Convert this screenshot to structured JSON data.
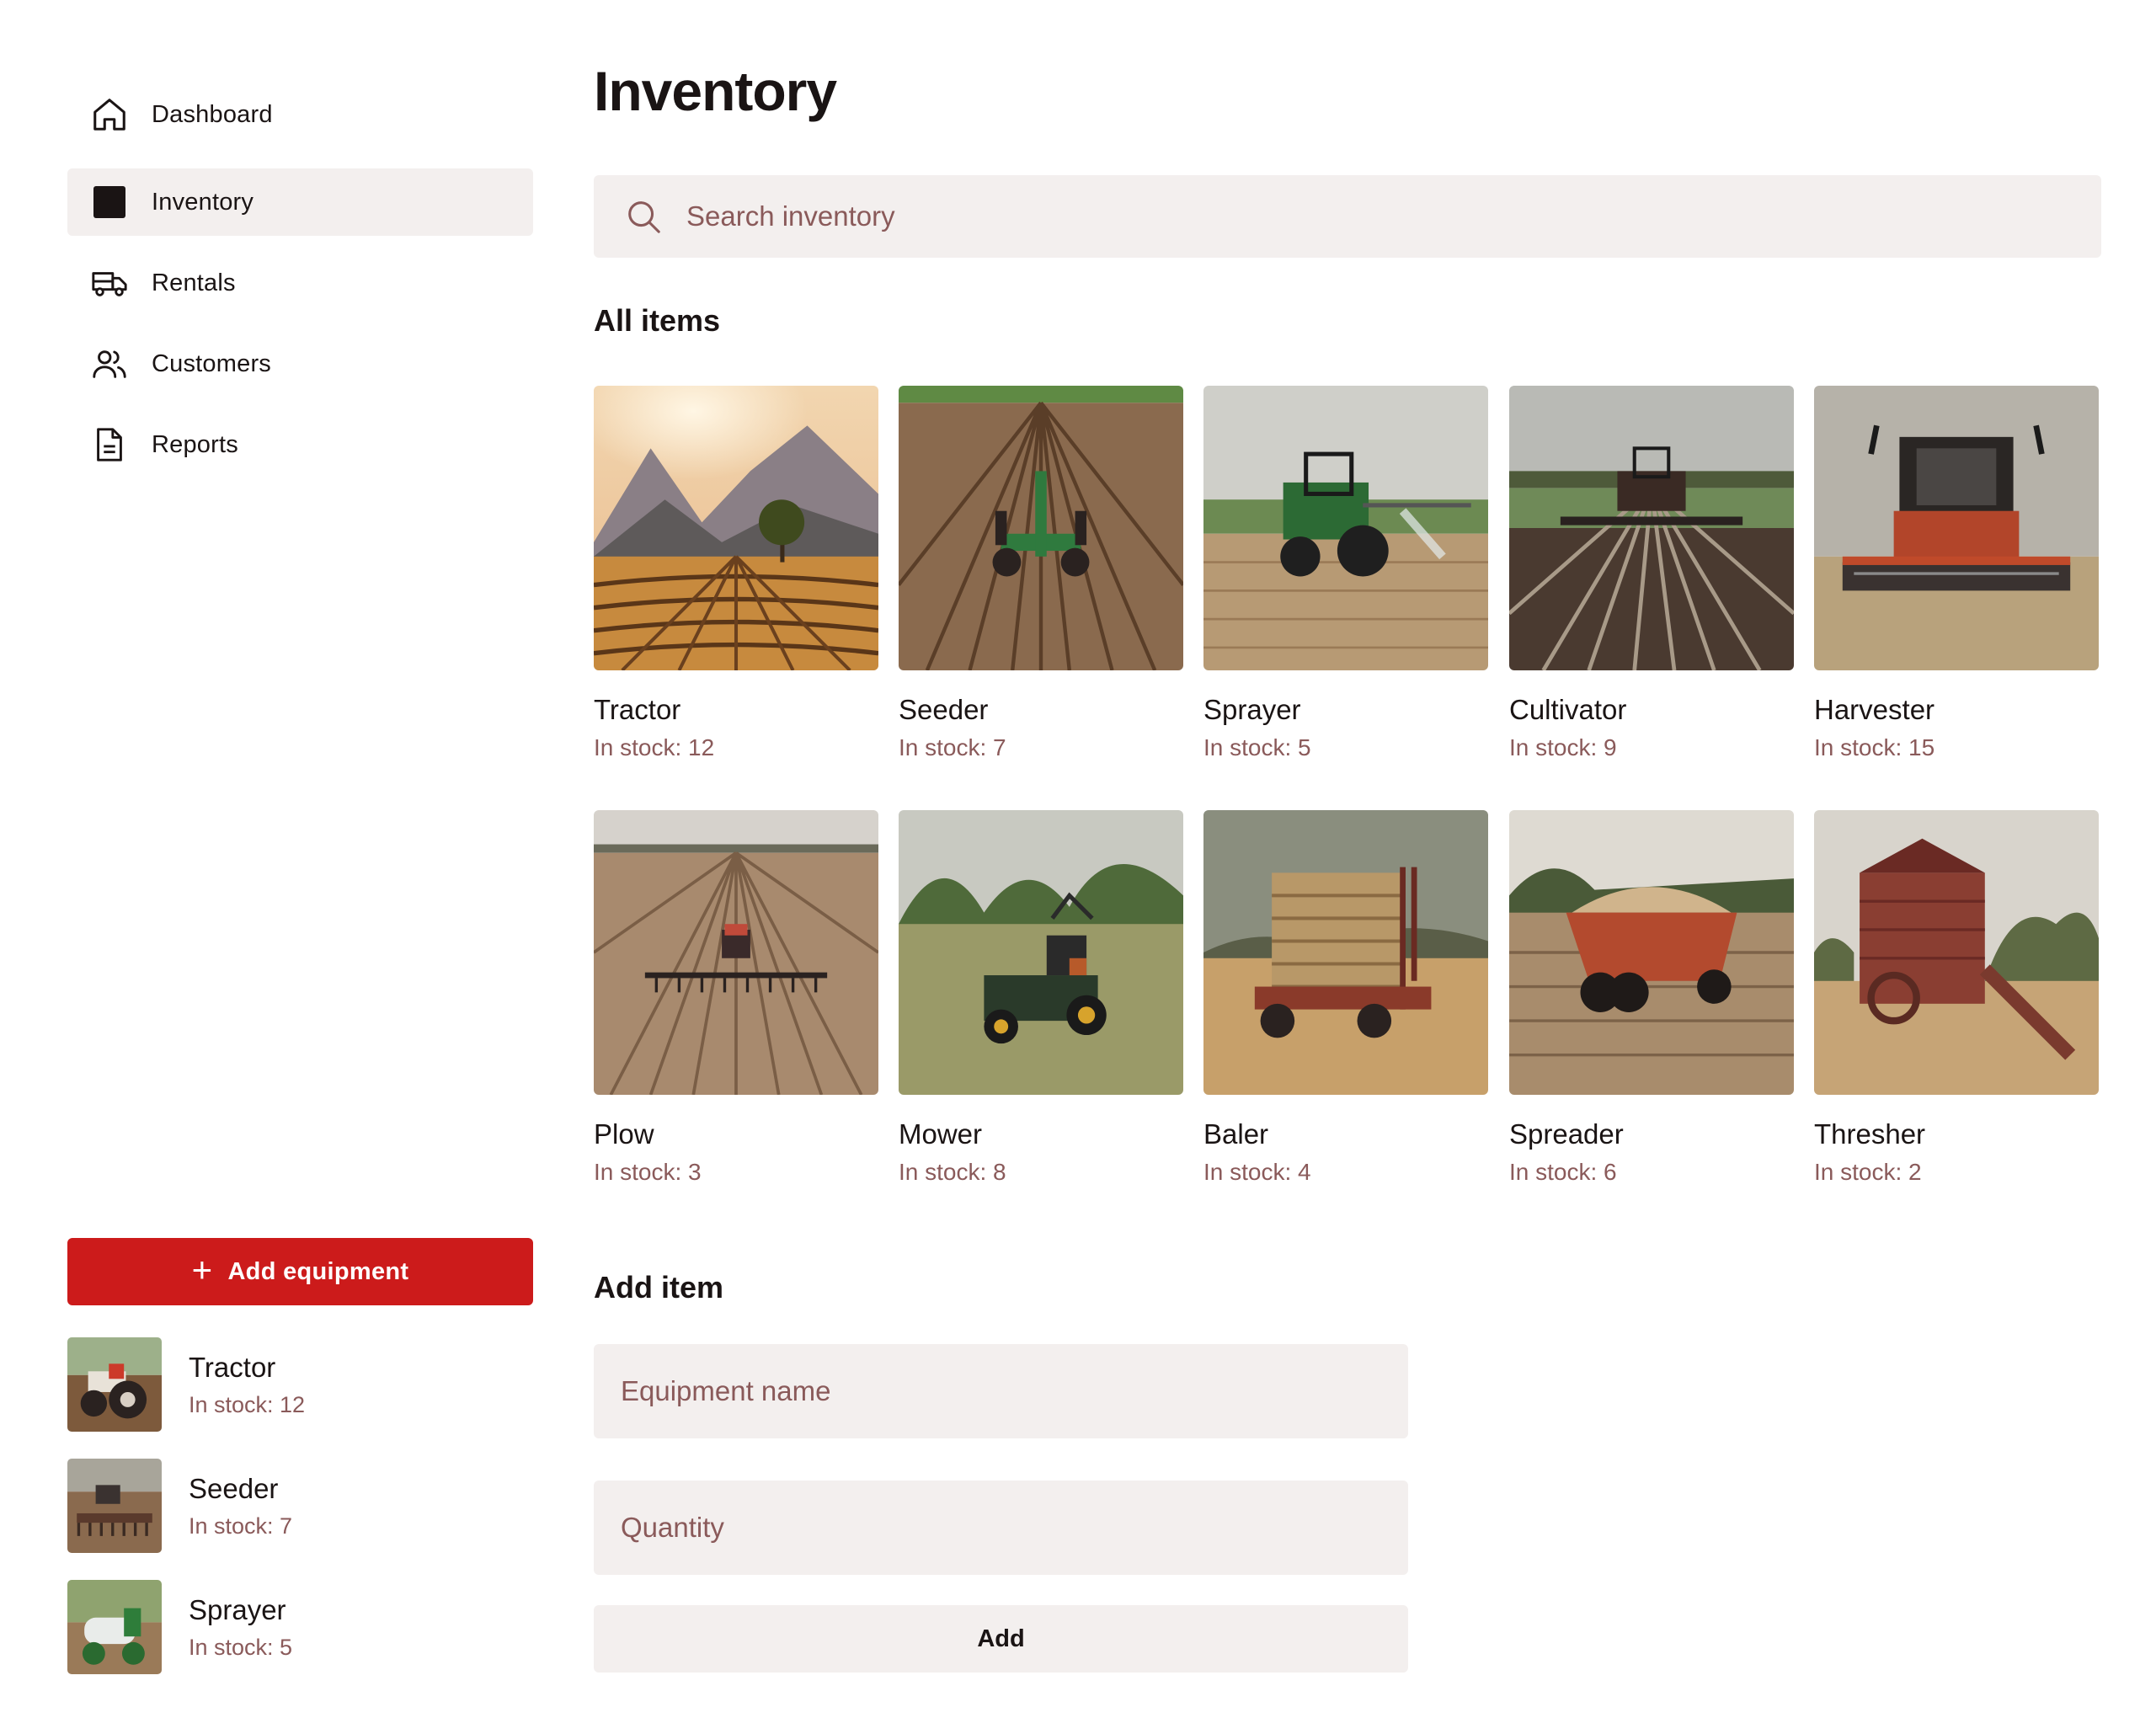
{
  "sidebar": {
    "nav": [
      {
        "label": "Dashboard",
        "icon": "home-icon",
        "active": false
      },
      {
        "label": "Inventory",
        "icon": "square-icon",
        "active": true
      },
      {
        "label": "Rentals",
        "icon": "truck-icon",
        "active": false
      },
      {
        "label": "Customers",
        "icon": "users-icon",
        "active": false
      },
      {
        "label": "Reports",
        "icon": "document-icon",
        "active": false
      }
    ],
    "add_button": {
      "label": "Add equipment",
      "icon": "plus-icon",
      "color": "#cc1b1b"
    },
    "recent": [
      {
        "name": "Tractor",
        "stock": "In stock: 12"
      },
      {
        "name": "Seeder",
        "stock": "In stock: 7"
      },
      {
        "name": "Sprayer",
        "stock": "In stock: 5"
      }
    ]
  },
  "main": {
    "title": "Inventory",
    "search": {
      "placeholder": "Search inventory",
      "value": ""
    },
    "all_items_title": "All items",
    "items": [
      {
        "name": "Tractor",
        "stock": "In stock: 12"
      },
      {
        "name": "Seeder",
        "stock": "In stock: 7"
      },
      {
        "name": "Sprayer",
        "stock": "In stock: 5"
      },
      {
        "name": "Cultivator",
        "stock": "In stock: 9"
      },
      {
        "name": "Harvester",
        "stock": "In stock: 15"
      },
      {
        "name": "Plow",
        "stock": "In stock: 3"
      },
      {
        "name": "Mower",
        "stock": "In stock: 8"
      },
      {
        "name": "Baler",
        "stock": "In stock: 4"
      },
      {
        "name": "Spreader",
        "stock": "In stock: 6"
      },
      {
        "name": "Thresher",
        "stock": "In stock: 2"
      }
    ],
    "add_item": {
      "title": "Add item",
      "name_placeholder": "Equipment name",
      "quantity_placeholder": "Quantity",
      "submit_label": "Add"
    }
  },
  "colors": {
    "accent": "#cc1b1b",
    "surface": "#f3efee",
    "muted_text": "#8a5a5a",
    "text": "#1a1414"
  }
}
